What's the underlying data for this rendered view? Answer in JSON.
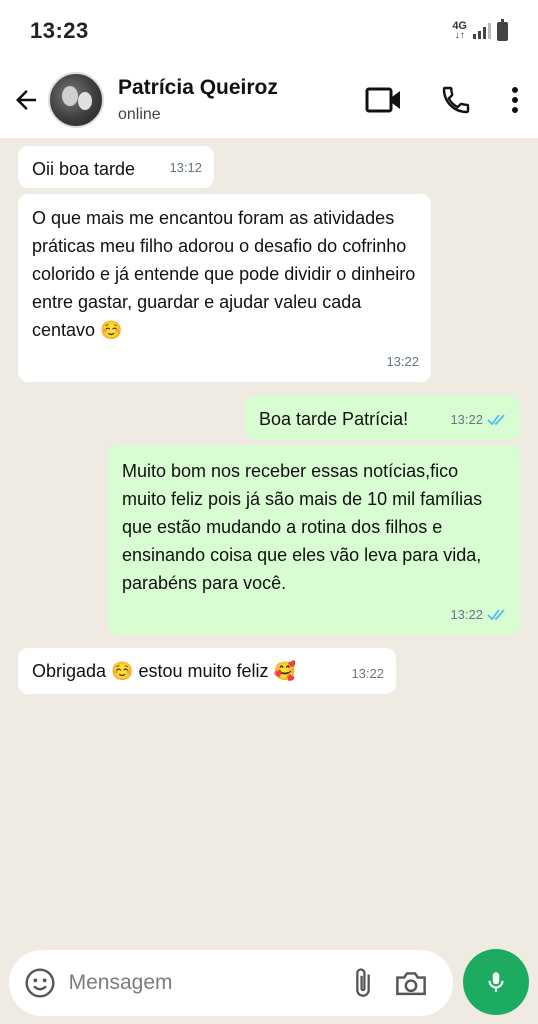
{
  "status_bar": {
    "time": "13:23",
    "network": "4G",
    "icons": [
      "network-4g-icon",
      "signal-icon",
      "battery-icon"
    ]
  },
  "header": {
    "contact_name": "Patrícia Queiroz",
    "contact_status": "online",
    "icons": [
      "back-arrow-icon",
      "video-call-icon",
      "phone-icon",
      "more-vert-icon"
    ]
  },
  "messages": [
    {
      "direction": "incoming",
      "text": "Oii boa tarde",
      "time": "13:12"
    },
    {
      "direction": "incoming",
      "text": "O que mais me encantou foram as atividades práticas meu filho adorou o desafio do cofrinho colorido e já entende que pode dividir o dinheiro entre gastar, guardar e ajudar valeu cada centavo ☺️",
      "time": "13:22"
    },
    {
      "direction": "outgoing",
      "text": "Boa tarde Patrícia!",
      "time": "13:22",
      "read": true
    },
    {
      "direction": "outgoing",
      "text": "Muito bom nos receber essas notícias,fico muito feliz pois já são mais de 10 mil famílias que estão mudando a rotina dos filhos e ensinando coisa que eles vão leva para vida, parabéns para você.",
      "time": "13:22",
      "read": true
    },
    {
      "direction": "incoming",
      "text": "Obrigada ☺️ estou muito feliz 🥰",
      "time": "13:22"
    }
  ],
  "composer": {
    "placeholder": "Mensagem",
    "icons": [
      "emoji-icon",
      "attach-icon",
      "camera-icon",
      "mic-icon"
    ]
  },
  "colors": {
    "chat_background": "#efeae2",
    "incoming_bubble": "#ffffff",
    "outgoing_bubble": "#d9fdd3",
    "read_ticks": "#53bdeb",
    "mic_button": "#1daa61"
  }
}
